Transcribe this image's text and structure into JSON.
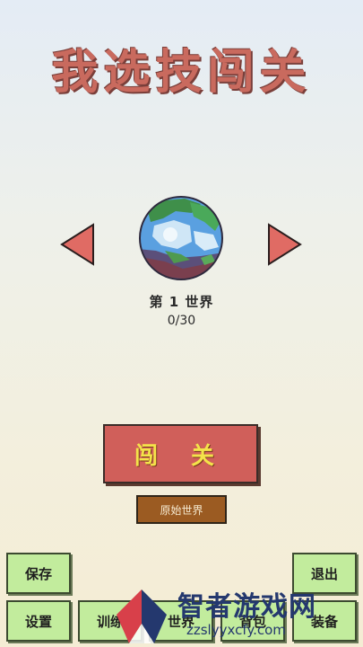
{
  "title": "我选技闯关",
  "world": {
    "name": "第 1 世界",
    "progress": "0/30"
  },
  "buttons": {
    "challenge": "闯 关",
    "origin_world": "原始世界",
    "save": "保存",
    "settings": "设置",
    "train": "训练",
    "world": "世界",
    "backpack": "背包",
    "equipment": "装备",
    "exit": "退出"
  },
  "watermark": {
    "brand": "智者游戏网",
    "url": "zzslyyxcfy.com"
  },
  "colors": {
    "title": "#c96a5e",
    "arrow": "#e06b64",
    "challenge_bg": "#d05f5a",
    "challenge_text": "#f4e34a",
    "origin_bg": "#9b5b22",
    "menu_bg": "#c2ec9d"
  },
  "icons": [
    "arrow-left-icon",
    "arrow-right-icon",
    "planet-icon"
  ]
}
